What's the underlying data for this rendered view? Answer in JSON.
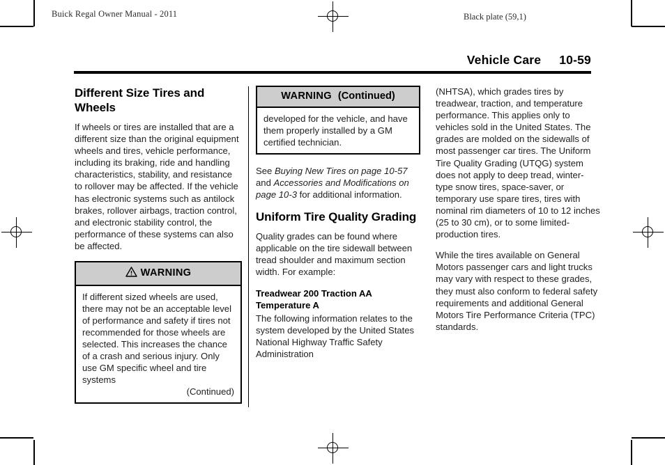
{
  "document": {
    "manual_title": "Buick Regal Owner Manual - 2011",
    "black_plate": "Black plate (59,1)",
    "header": {
      "section": "Vehicle Care",
      "page_number": "10-59"
    }
  },
  "column_1": {
    "heading": "Different Size Tires and Wheels",
    "paragraph": "If wheels or tires are installed that are a different size than the original equipment wheels and tires, vehicle performance, including its braking, ride and handling characteristics, stability, and resistance to rollover may be affected. If the vehicle has electronic systems such as antilock brakes, rollover airbags, traction control, and electronic stability control, the performance of these systems can also be affected.",
    "warning": {
      "label": "WARNING",
      "icon": "warning-triangle-icon",
      "body": "If different sized wheels are used, there may not be an acceptable level of performance and safety if tires not recommended for those wheels are selected. This increases the chance of a crash and serious injury. Only use GM specific wheel and tire systems",
      "continued": "(Continued)"
    }
  },
  "column_2": {
    "warning_continued": {
      "label": "WARNING",
      "continued_label": "(Continued)",
      "body": "developed for the vehicle, and have them properly installed by a GM certified technician."
    },
    "cross_reference": {
      "lead": "See ",
      "ref_1": "Buying New Tires on page 10-57",
      "conjunction": " and ",
      "ref_2": "Accessories and Modifications on page 10-3",
      "tail": " for additional information."
    },
    "heading": "Uniform Tire Quality Grading",
    "paragraph_1": "Quality grades can be found where applicable on the tire sidewall between tread shoulder and maximum section width. For example:",
    "example_grades": "Treadwear 200 Traction AA Temperature A",
    "paragraph_2": "The following information relates to the system developed by the United States National Highway Traffic Safety Administration"
  },
  "column_3": {
    "paragraph_1": "(NHTSA), which grades tires by treadwear, traction, and temperature performance. This applies only to vehicles sold in the United States. The grades are molded on the sidewalls of most passenger car tires. The Uniform Tire Quality Grading (UTQG) system does not apply to deep tread, winter-type snow tires, space-saver, or temporary use spare tires, tires with nominal rim diameters of 10 to 12 inches (25 to 30 cm), or to some limited-production tires.",
    "paragraph_2": "While the tires available on General Motors passenger cars and light trucks may vary with respect to these grades, they must also conform to federal safety requirements and additional General Motors Tire Performance Criteria (TPC) standards."
  },
  "colors": {
    "text": "#1f1f1f",
    "rule": "#000000",
    "warning_header_bg": "#cdcdcd",
    "page_bg": "#ffffff"
  }
}
